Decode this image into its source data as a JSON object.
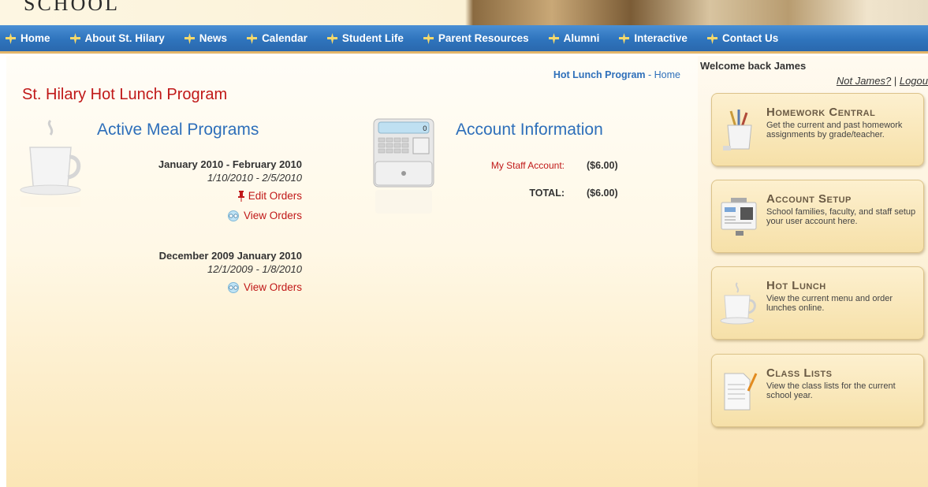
{
  "header": {
    "school_word": "SCHOOL"
  },
  "nav": {
    "items": [
      {
        "label": "Home"
      },
      {
        "label": "About St. Hilary"
      },
      {
        "label": "News"
      },
      {
        "label": "Calendar"
      },
      {
        "label": "Student Life"
      },
      {
        "label": "Parent Resources"
      },
      {
        "label": "Alumni"
      },
      {
        "label": "Interactive"
      },
      {
        "label": "Contact Us"
      }
    ]
  },
  "breadcrumb": {
    "link": "Hot Lunch Program",
    "separator": " - ",
    "current": "Home"
  },
  "page_title": "St. Hilary Hot Lunch Program",
  "meal_programs": {
    "title": "Active Meal Programs",
    "programs": [
      {
        "name": "January 2010 - February 2010",
        "dates": "1/10/2010 - 2/5/2010",
        "edit_label": "Edit Orders",
        "view_label": "View Orders"
      },
      {
        "name": "December 2009 January 2010",
        "dates": "12/1/2009 - 1/8/2010",
        "view_label": "View Orders"
      }
    ]
  },
  "account": {
    "title": "Account Information",
    "rows": [
      {
        "label": "My Staff Account:",
        "value": "($6.00)"
      },
      {
        "label": "TOTAL:",
        "value": "($6.00)"
      }
    ]
  },
  "sidebar": {
    "welcome": "Welcome back James",
    "not_user": "Not James?",
    "separator": " | ",
    "logout": "Logou",
    "cards": [
      {
        "title": "Homework Central",
        "desc": "Get the current and past homework assignments by grade/teacher.",
        "icon": "pencil-cup-icon"
      },
      {
        "title": "Account Setup",
        "desc": "School families, faculty, and staff setup your user account here.",
        "icon": "id-card-icon"
      },
      {
        "title": "Hot Lunch",
        "desc": "View the current menu and order lunches online.",
        "icon": "coffee-cup-icon"
      },
      {
        "title": "Class Lists",
        "desc": "View the class lists for the current school year.",
        "icon": "notepad-icon"
      }
    ]
  },
  "colors": {
    "nav_blue": "#2f74bd",
    "title_red": "#c01818",
    "link_blue": "#2e6fba",
    "gold": "#e3b66b"
  }
}
